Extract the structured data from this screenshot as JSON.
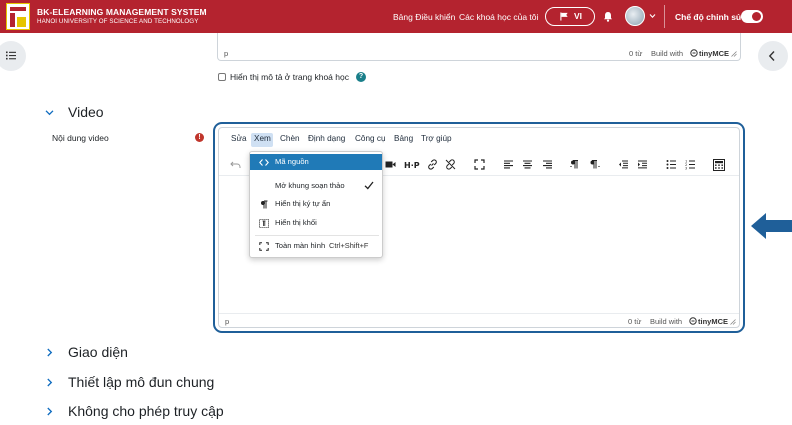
{
  "header": {
    "brand_title": "BK-ELEARNING MANAGEMENT SYSTEM",
    "brand_subtitle": "HANOI UNIVERSITY OF SCIENCE AND TECHNOLOGY",
    "nav_dashboard": "Bảng Điều khiển",
    "nav_my_courses": "Các khoá học của tôi",
    "language": "VI",
    "edit_mode_label": "Chế độ chỉnh sửa",
    "edit_mode_on": true,
    "brand_color": "#b4232f"
  },
  "top_editor": {
    "path": "p",
    "word_count": "0 từ",
    "build_with": "Build with",
    "tinymce": "tinyMCE"
  },
  "show_description": {
    "label": "Hiển thị mô tả ở trang khoá học",
    "checked": false,
    "help": "?"
  },
  "sections": {
    "video": {
      "title": "Video",
      "expanded": true
    },
    "appearance": {
      "title": "Giao diện",
      "expanded": false
    },
    "common_settings": {
      "title": "Thiết lập mô đun chung",
      "expanded": false
    },
    "restrict_access": {
      "title": "Không cho phép truy cập",
      "expanded": false
    }
  },
  "video_field": {
    "label": "Nội dung video",
    "required_icon": "!"
  },
  "editor": {
    "menus": [
      "Sửa",
      "Xem",
      "Chèn",
      "Định dạng",
      "Công cụ",
      "Bảng",
      "Trợ giúp"
    ],
    "active_menu": "Xem",
    "toolbar_icons": [
      "undo-icon",
      "video-icon",
      "h5p-icon",
      "link-icon",
      "unlink-icon",
      "fullscreen-icon",
      "align-left-icon",
      "align-center-icon",
      "align-right-icon",
      "ltr-icon",
      "rtl-icon",
      "outdent-icon",
      "indent-icon",
      "bullet-list-icon",
      "numbered-list-icon",
      "calculator-icon"
    ],
    "status_path": "p",
    "word_count": "0 từ",
    "build_with": "Build with",
    "tinymce": "tinyMCE"
  },
  "view_menu": {
    "items": [
      {
        "label": "Mã nguồn",
        "icon": "code-icon",
        "active": true
      },
      {
        "label": "Mở khung soạn thảo",
        "checked": true
      },
      {
        "label": "Hiển thị ký tự ẩn",
        "icon": "pilcrow-icon"
      },
      {
        "label": "Hiển thị khối",
        "icon": "show-blocks-icon"
      },
      {
        "label": "Toàn màn hình",
        "icon": "fullscreen-icon",
        "shortcut": "Ctrl+Shift+F"
      }
    ],
    "active_color": "#207ab7"
  },
  "annotation": {
    "arrow_color": "#1f5f99",
    "frame_color": "#1f5f99"
  }
}
